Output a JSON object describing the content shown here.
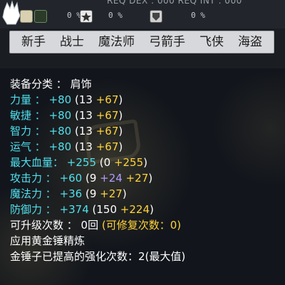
{
  "top": {
    "req_text": "REQ DEX : 000   REQ INT : 000",
    "slot_a_percent": "0 %",
    "slot_b_percent": "0 %",
    "slot_c_percent": "0 %"
  },
  "jobs": [
    "新手",
    "战士",
    "魔法师",
    "弓箭手",
    "飞侠",
    "海盗"
  ],
  "equip": {
    "category_label": "装备分类 ：",
    "category_value": "肩饰"
  },
  "stats": [
    {
      "label": "力量 ：",
      "value": "+80",
      "open": " (13 ",
      "add1": "+67",
      "add2": "",
      "close": ")"
    },
    {
      "label": "敏捷 ：",
      "value": "+80",
      "open": " (13 ",
      "add1": "+67",
      "add2": "",
      "close": ")"
    },
    {
      "label": "智力 ：",
      "value": "+80",
      "open": " (13 ",
      "add1": "+67",
      "add2": "",
      "close": ")"
    },
    {
      "label": "运气 ：",
      "value": "+80",
      "open": " (13 ",
      "add1": "+67",
      "add2": "",
      "close": ")"
    },
    {
      "label": "最大血量：",
      "value": "+255",
      "open": " (0 ",
      "add1": "+255",
      "add2": "",
      "close": ")"
    },
    {
      "label": "攻击力 ：",
      "value": "+60",
      "open": " (9 ",
      "add1": "+24",
      "add2": " +27",
      "close": ")"
    },
    {
      "label": "魔法力 ：",
      "value": "+36",
      "open": " (9 ",
      "add1": "+27",
      "add2": "",
      "close": ")"
    },
    {
      "label": "防御力 ：",
      "value": "+374",
      "open": " (150 ",
      "add1": "+224",
      "add2": "",
      "close": ")"
    }
  ],
  "upgrade": {
    "label": "可升级次数 ： ",
    "value": "0回",
    "restore": "  (可修复次数：0)"
  },
  "hammer_applied": "应用黄金锤精炼",
  "hammer_count": "金锤子已提高的强化次数：2(最大值)",
  "colors": {
    "cyan": "#4fe0ee",
    "gold": "#ffd23a",
    "purple": "#b09cff",
    "tab_bar": "#d7d8dc"
  },
  "icons": [
    "glove-icon",
    "scroll-icon",
    "star-icon",
    "shield-icon"
  ]
}
